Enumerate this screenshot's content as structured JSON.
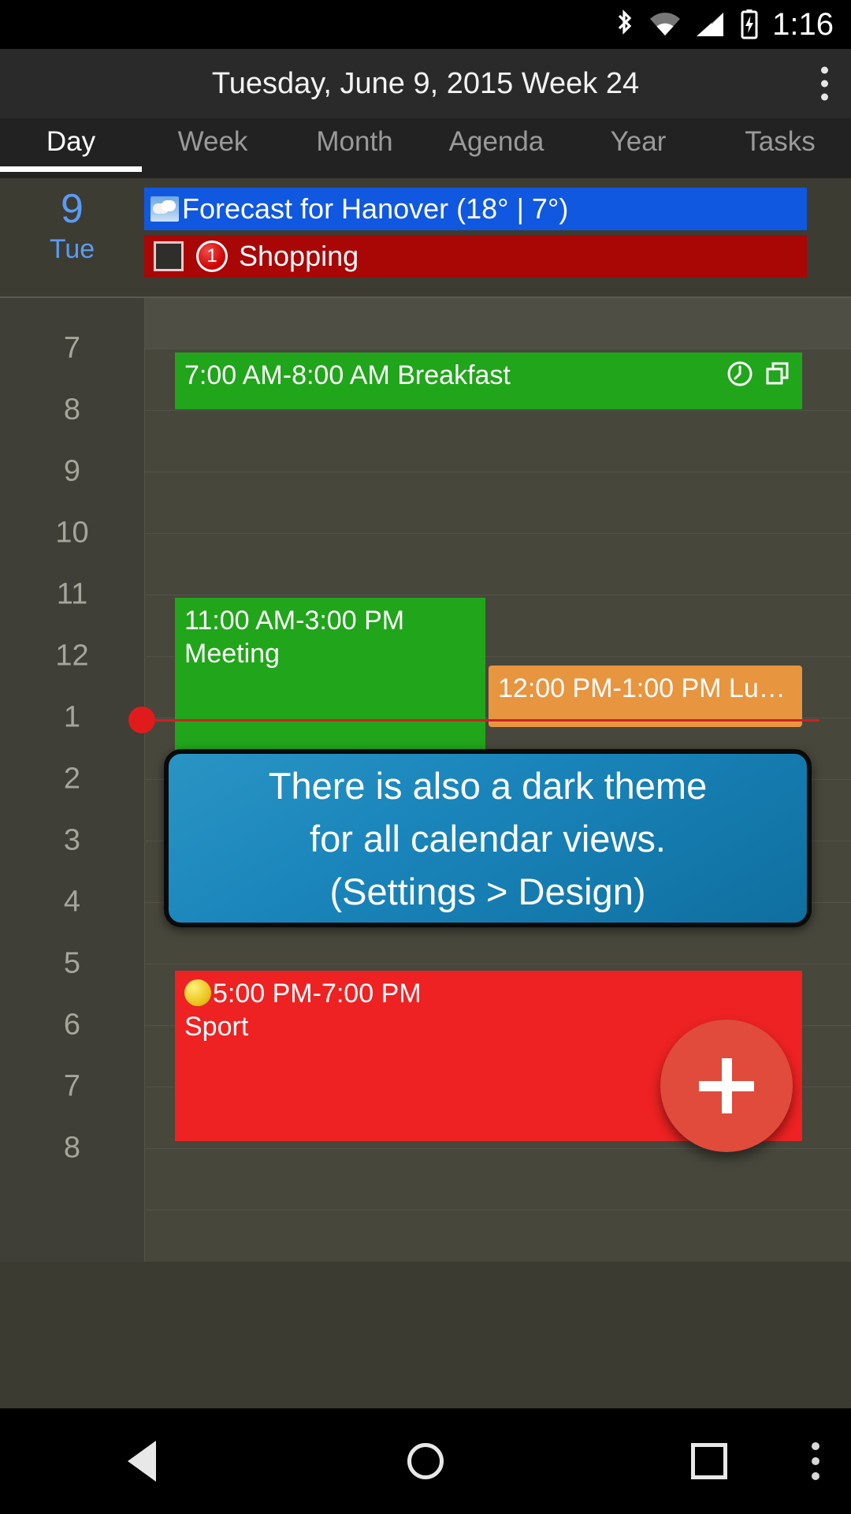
{
  "statusbar": {
    "time": "1:16",
    "icons": [
      "bluetooth-icon",
      "wifi-icon",
      "signal-icon",
      "battery-charging-icon"
    ]
  },
  "actionbar": {
    "title": "Tuesday, June 9, 2015 Week 24",
    "overflow_label": "overflow-menu"
  },
  "tabs": [
    {
      "label": "Day",
      "active": true
    },
    {
      "label": "Week",
      "active": false
    },
    {
      "label": "Month",
      "active": false
    },
    {
      "label": "Agenda",
      "active": false
    },
    {
      "label": "Year",
      "active": false
    },
    {
      "label": "Tasks",
      "active": false
    }
  ],
  "day_header": {
    "day_number": "9",
    "day_name": "Tue",
    "allday_events": [
      {
        "text": "Forecast for Hanover (18° | 7°)",
        "color": "#1158e0",
        "icon": "weather-cloud-icon",
        "type": "forecast"
      },
      {
        "text": "Shopping",
        "color": "#a90606",
        "badge": "1",
        "checkbox": "unchecked",
        "type": "task"
      }
    ]
  },
  "grid": {
    "hours": [
      "7",
      "8",
      "9",
      "10",
      "11",
      "12",
      "1",
      "2",
      "3",
      "4",
      "5",
      "6",
      "7",
      "8"
    ],
    "current_time_label": "1:16 PM"
  },
  "events": [
    {
      "time": "7:00 AM-8:00 AM",
      "title": "Breakfast",
      "text": "7:00 AM-8:00 AM Breakfast",
      "color": "#21a51b",
      "icons": [
        "alarm-clock-icon",
        "repeat-copy-icon"
      ]
    },
    {
      "time": "11:00 AM-3:00 PM",
      "title": "Meeting",
      "text": "11:00 AM-3:00 PM",
      "color": "#21a51b"
    },
    {
      "time": "12:00 PM-1:00 PM",
      "title": "Lu…",
      "text": "12:00 PM-1:00 PM Lu…",
      "color": "#e89540"
    },
    {
      "time": "5:00 PM-7:00 PM",
      "title": "Sport",
      "text": "5:00 PM-7:00 PM",
      "color": "#ee2222",
      "icon": "sport-ball-icon"
    }
  ],
  "tooltip": {
    "line1": "There is also a dark theme",
    "line2": "for all calendar views.",
    "line3": "(Settings > Design)",
    "accent": "#1a85bb"
  },
  "fab": {
    "label": "+",
    "name": "add-event-button",
    "color": "#e04b3c"
  },
  "navbar": {
    "buttons": [
      "back-button",
      "home-button",
      "recents-button",
      "more-button"
    ]
  }
}
